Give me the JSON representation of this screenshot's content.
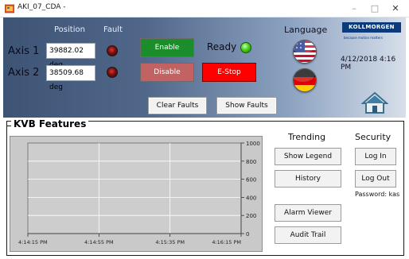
{
  "window": {
    "title": "AKI_07_CDA -",
    "minimize_glyph": "–",
    "maximize_glyph": "□",
    "close_glyph": "✕"
  },
  "header": {
    "position_label": "Position",
    "fault_label": "Fault",
    "axes": [
      {
        "label": "Axis 1",
        "position": "39882.02 deg"
      },
      {
        "label": "Axis 2",
        "position": "38509.68 deg"
      }
    ],
    "enable_label": "Enable",
    "disable_label": "Disable",
    "estop_label": "E-Stop",
    "ready_label": "Ready",
    "language_label": "Language",
    "languages": [
      "English",
      "German"
    ],
    "logo_text": "KOLLMORGEN",
    "logo_tagline": "because motion matters",
    "datetime": "4/12/2018 4:16 PM",
    "clear_faults_label": "Clear Faults",
    "show_faults_label": "Show Faults"
  },
  "features": {
    "title": "KVB Features",
    "trending": {
      "title": "Trending",
      "show_legend_label": "Show Legend",
      "history_label": "History"
    },
    "security": {
      "title": "Security",
      "login_label": "Log In",
      "logout_label": "Log Out",
      "password_text": "Password: kas"
    },
    "alarm_viewer_label": "Alarm Viewer",
    "audit_trail_label": "Audit Trail"
  },
  "colors": {
    "enable": "#1b8d2a",
    "disable": "#c36262",
    "estop": "#ff0000",
    "ready_led": "#45d21a",
    "fault_led": "#7a0f0f",
    "header_gradient_start": "#3e5475",
    "header_gradient_end": "#d7dfea",
    "logo_blue": "#0c3a7a"
  },
  "chart_data": {
    "type": "line",
    "title": "",
    "xlabel": "",
    "ylabel": "",
    "x_ticks": [
      "4:14:15 PM",
      "4:14:55 PM",
      "4:15:35 PM",
      "4:16:15 PM"
    ],
    "y_ticks": [
      0,
      200,
      400,
      600,
      800,
      1000
    ],
    "ylim": [
      0,
      1000
    ],
    "y_axis_side": "right",
    "grid": true,
    "series": []
  }
}
